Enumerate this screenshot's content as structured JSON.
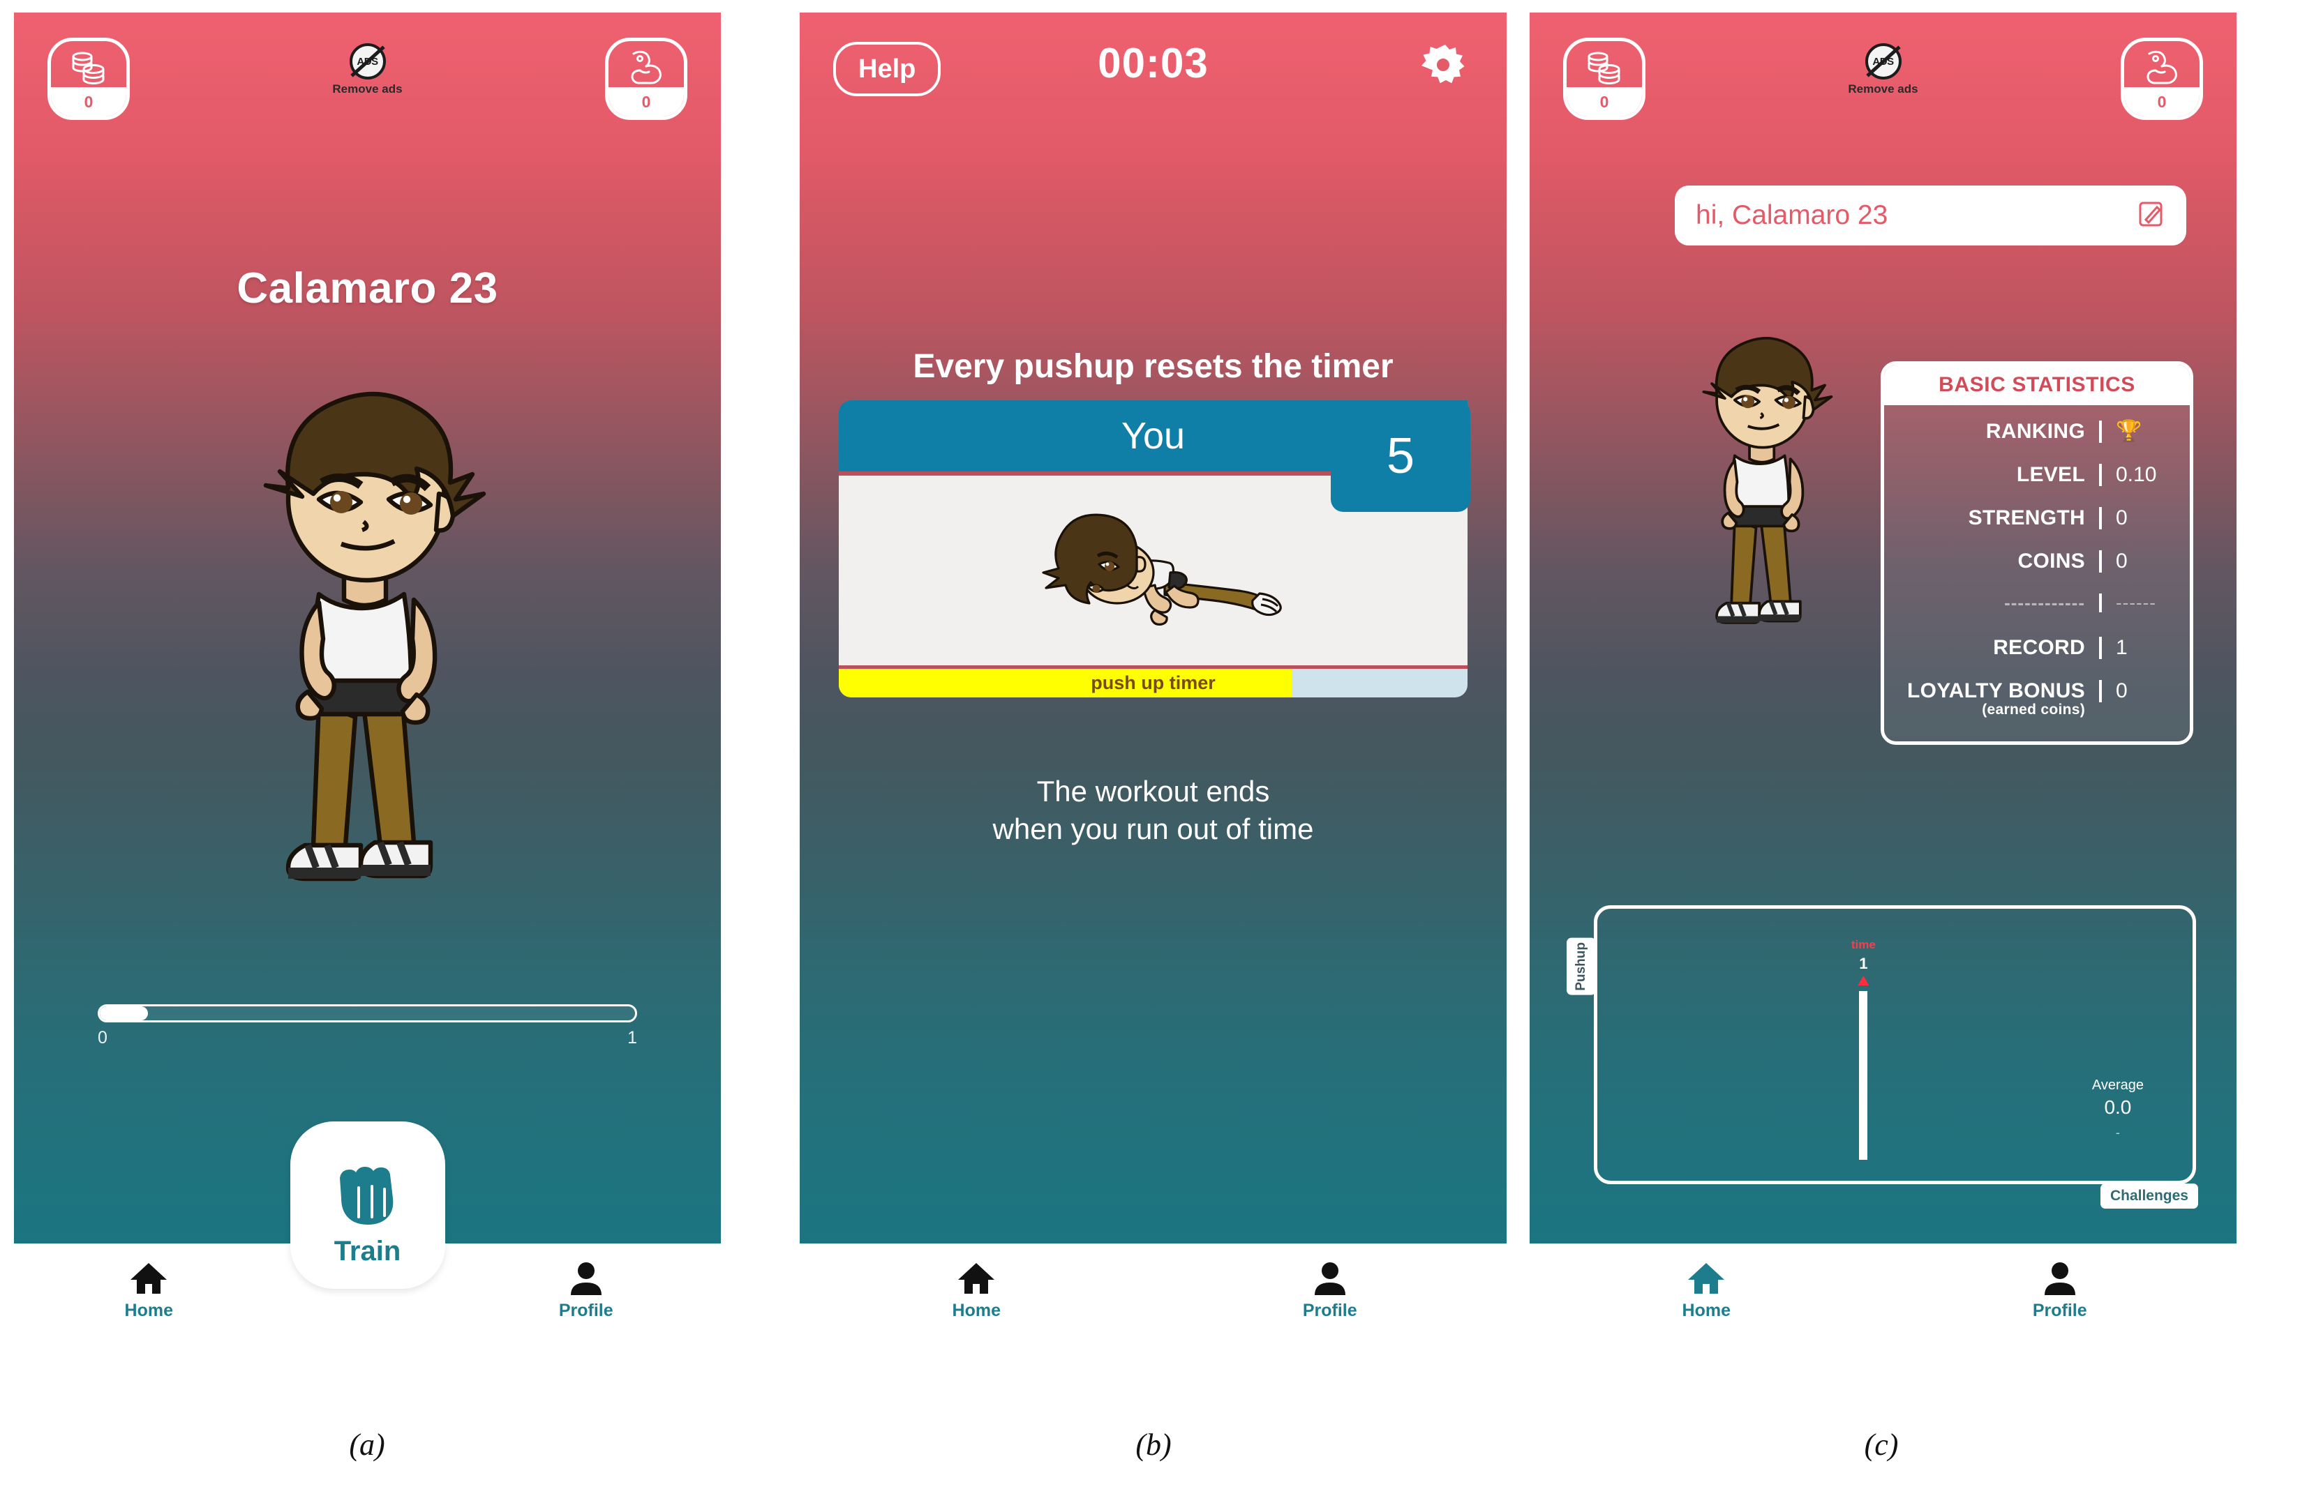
{
  "figure": {
    "captions": [
      {
        "id": "a",
        "text": "(a)"
      },
      {
        "id": "b",
        "text": "(b)"
      },
      {
        "id": "c",
        "text": "(c)"
      }
    ]
  },
  "colors": {
    "gradient_top": "#ef6170",
    "gradient_bottom": "#187581",
    "accent_teal": "#1d7d8c",
    "card_teal": "#0f7fa8",
    "card_border_red": "#bd4f5b",
    "timer_fill_yellow": "#ffff00",
    "timer_track_blue": "#cfe3ec",
    "white": "#ffffff",
    "stat_label_red": "#d34a58",
    "chart_marker_red": "#ff2e3e"
  },
  "hud": {
    "coins": {
      "icon": "coin-stack-icon",
      "value": "0"
    },
    "remove_ads": {
      "icon": "no-ads-icon",
      "badge_text": "ADS",
      "label": "Remove ads"
    },
    "strength": {
      "icon": "biceps-icon",
      "value": "0"
    }
  },
  "bottom_nav": {
    "items": [
      {
        "icon": "home-icon",
        "label": "Home"
      },
      {
        "icon": "profile-icon",
        "label": "Profile"
      }
    ]
  },
  "screen_a": {
    "username": "Calamaro 23",
    "avatar": "character-standing-avatar",
    "progress": {
      "min_label": "0",
      "max_label": "1",
      "percent": 9
    },
    "train_button": {
      "icon": "fist-icon",
      "label": "Train"
    }
  },
  "screen_b": {
    "help_button": "Help",
    "timer": "00:03",
    "settings_icon": "gear-icon",
    "headline": "Every pushup resets the timer",
    "counter_card": {
      "label": "You",
      "count": "5",
      "illustration": "character-pushup-pose",
      "timer_bar": {
        "caption": "push up timer",
        "percent": 72
      }
    },
    "subcopy_line1": "The workout ends",
    "subcopy_line2": "when you run out of time"
  },
  "screen_c": {
    "greeting": "hi, Calamaro 23",
    "edit_icon": "edit-pencil-icon",
    "avatar": "character-standing-avatar",
    "stats": {
      "title": "BASIC STATISTICS",
      "rows": [
        {
          "label": "RANKING",
          "sublabel": "",
          "value": "🏆",
          "divider": false
        },
        {
          "label": "LEVEL",
          "sublabel": "",
          "value": "0.10",
          "divider": false
        },
        {
          "label": "STRENGTH",
          "sublabel": "",
          "value": "0",
          "divider": false
        },
        {
          "label": "COINS",
          "sublabel": "",
          "value": "0",
          "divider": false
        },
        {
          "label": "------------",
          "sublabel": "",
          "value": "------",
          "divider": true
        },
        {
          "label": "RECORD",
          "sublabel": "",
          "value": "1",
          "divider": false
        },
        {
          "label": "LOYALTY BONUS",
          "sublabel": "(earned coins)",
          "value": "0",
          "divider": false
        }
      ]
    },
    "chart_tabs": {
      "left_tab": "Pushup",
      "bottom_tab": "Challenges"
    },
    "chart_average": {
      "label": "Average",
      "value": "0.0",
      "tick": "-"
    }
  },
  "chart_data": {
    "type": "bar",
    "title": "Pushup",
    "categories": [
      "time"
    ],
    "values": [
      1
    ],
    "data_labels": [
      "1"
    ],
    "xlabel": "",
    "ylabel": "Pushup",
    "ylim": [
      0,
      1
    ],
    "grid": false,
    "legend": "none",
    "annotations": [
      {
        "text": "Average",
        "value": "0.0"
      }
    ]
  }
}
